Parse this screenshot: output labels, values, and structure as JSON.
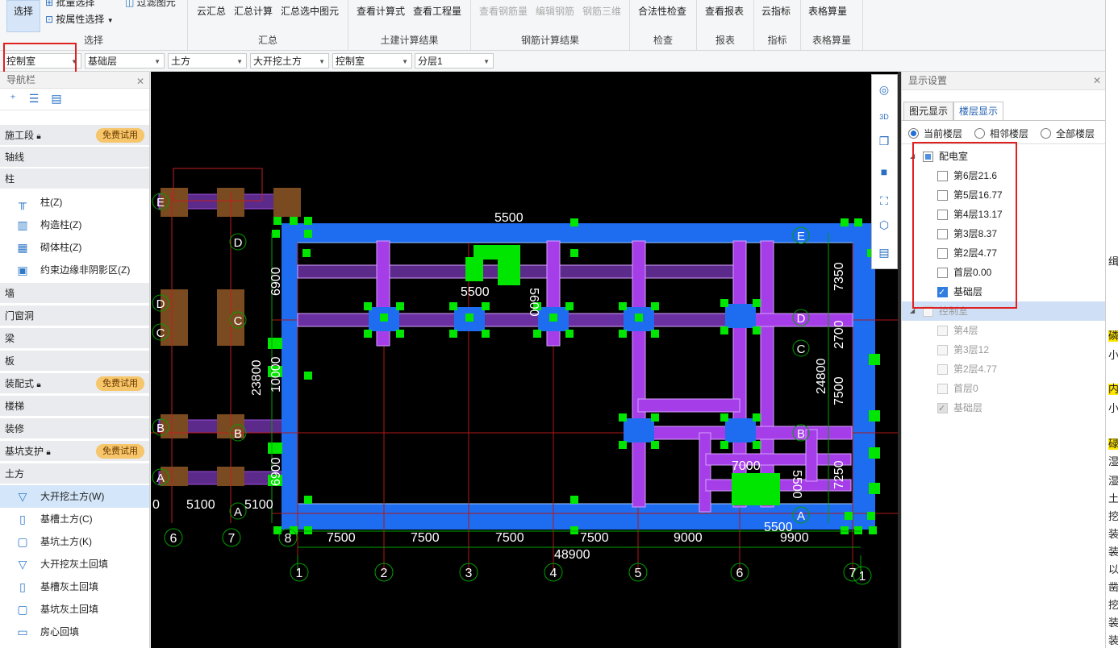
{
  "ribbon": {
    "select_group": {
      "select_label": "选择",
      "batch_select": "批量选择",
      "attr_select": "按属性选择",
      "filter_label": "过滤图元",
      "title": "选择"
    },
    "summary_group": {
      "items": [
        "云汇总",
        "汇总计算",
        "汇总选中图元"
      ],
      "title": "汇总"
    },
    "civil_group": {
      "items": [
        "查看计算式",
        "查看工程量"
      ],
      "title": "土建计算结果"
    },
    "rebar_group": {
      "items": [
        "查看钢筋量",
        "编辑钢筋",
        "钢筋三维"
      ],
      "title": "钢筋计算结果"
    },
    "check_group": {
      "items": [
        "合法性检查"
      ],
      "title": "检查"
    },
    "report_group": {
      "items": [
        "查看报表"
      ],
      "title": "报表"
    },
    "index_group": {
      "items": [
        "云指标"
      ],
      "title": "指标"
    },
    "table_group": {
      "items": [
        "表格算量"
      ],
      "title": "表格算量"
    }
  },
  "combos": [
    "控制室",
    "基础层",
    "土方",
    "大开挖土方",
    "控制室",
    "分层1"
  ],
  "nav": {
    "title": "导航栏",
    "categories": [
      {
        "label": "施工段",
        "locked": true,
        "badge": "免费试用"
      },
      {
        "label": "轴线"
      },
      {
        "label": "柱"
      },
      {
        "label": "墙"
      },
      {
        "label": "门窗洞"
      },
      {
        "label": "梁"
      },
      {
        "label": "板"
      },
      {
        "label": "装配式",
        "locked": true,
        "badge": "免费试用"
      },
      {
        "label": "楼梯"
      },
      {
        "label": "装修"
      },
      {
        "label": "基坑支护",
        "locked": true,
        "badge": "免费试用"
      },
      {
        "label": "土方"
      }
    ],
    "column_items": [
      "柱(Z)",
      "构造柱(Z)",
      "砌体柱(Z)",
      "约束边缘非阴影区(Z)"
    ],
    "earth_items": [
      "大开挖土方(W)",
      "基槽土方(C)",
      "基坑土方(K)",
      "大开挖灰土回填",
      "基槽灰土回填",
      "基坑灰土回填",
      "房心回填"
    ]
  },
  "display": {
    "title": "显示设置",
    "tabs": [
      "图元显示",
      "楼层显示"
    ],
    "radios": [
      "当前楼层",
      "相邻楼层",
      "全部楼层"
    ],
    "groups": [
      {
        "name": "配电室",
        "floors": [
          {
            "label": "第6层21.6",
            "checked": false
          },
          {
            "label": "第5层16.77",
            "checked": false
          },
          {
            "label": "第4层13.17",
            "checked": false
          },
          {
            "label": "第3层8.37",
            "checked": false
          },
          {
            "label": "第2层4.77",
            "checked": false
          },
          {
            "label": "首层0.00",
            "checked": false
          },
          {
            "label": "基础层",
            "checked": true
          }
        ]
      },
      {
        "name": "控制室",
        "floors": [
          {
            "label": "第4层",
            "checked": false
          },
          {
            "label": "第3层12",
            "checked": false
          },
          {
            "label": "第2层4.77",
            "checked": false
          },
          {
            "label": "首层0",
            "checked": false
          },
          {
            "label": "基础层",
            "checked": true
          }
        ]
      }
    ]
  },
  "drawing": {
    "bottom_axes": [
      "1",
      "2",
      "3",
      "4",
      "5",
      "6",
      "7",
      "1"
    ],
    "left_axes": [
      "6",
      "7",
      "8"
    ],
    "spans": [
      "7500",
      "7500",
      "7500",
      "7500",
      "9000",
      "9900"
    ],
    "total_width": "48900",
    "left_spans": [
      "0",
      "5100",
      "5100"
    ],
    "top_label": "5500",
    "dims_left": [
      "6900",
      "23800",
      "10000",
      "6900"
    ],
    "dims_right": [
      "7350",
      "2700",
      "24800",
      "7500",
      "7250"
    ],
    "row_axes_left": [
      "E",
      "D",
      "C",
      "B",
      "A"
    ],
    "row_axes_mid": [
      "D",
      "C",
      "B",
      "A"
    ],
    "row_axes_right": [
      "E",
      "D",
      "C",
      "B",
      "A"
    ],
    "misc_labels": [
      "5600",
      "5600",
      "5500",
      "7000",
      "5500",
      "5500"
    ],
    "vtool_label": "3D"
  },
  "edge_text": [
    "缉",
    "磷",
    "小",
    "内",
    "小",
    "碌",
    "湿",
    "湿",
    "土",
    "挖",
    "装",
    "装",
    "以",
    "凿",
    "挖",
    "装",
    "装"
  ],
  "colors": {
    "accent": "#2f7de1",
    "highlight": "#e02020",
    "badge": "#f7c56a",
    "wall": "#1e6cf0",
    "beam": "#a53ee8",
    "point": "#00e600"
  }
}
